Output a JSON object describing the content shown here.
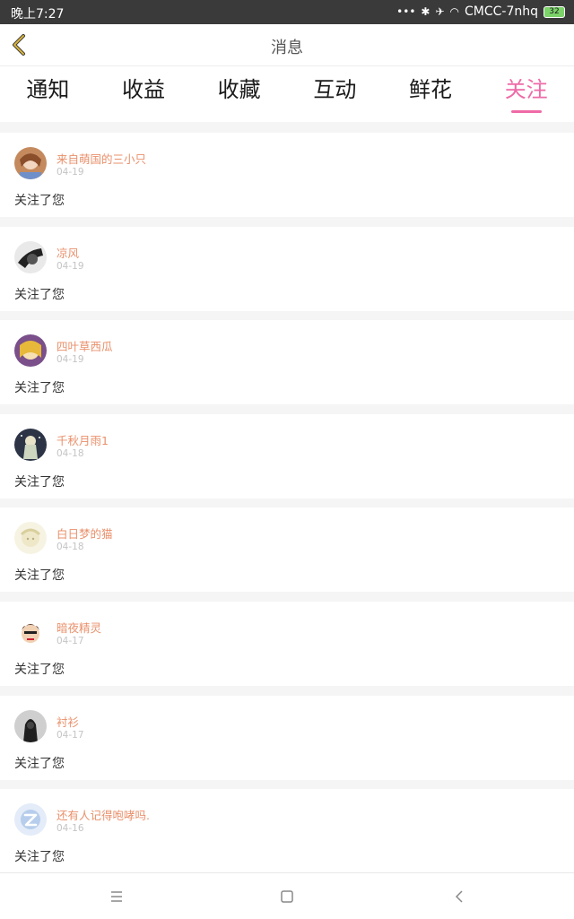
{
  "status_bar": {
    "time": "晚上7:27",
    "carrier": "CMCC-7nhq",
    "battery": "32"
  },
  "header": {
    "title": "消息"
  },
  "tabs": [
    {
      "label": "通知",
      "active": false
    },
    {
      "label": "收益",
      "active": false
    },
    {
      "label": "收藏",
      "active": false
    },
    {
      "label": "互动",
      "active": false
    },
    {
      "label": "鲜花",
      "active": false
    },
    {
      "label": "关注",
      "active": true
    }
  ],
  "colors": {
    "accent": "#ee6aa7",
    "username": "#e9906b",
    "date": "#c4c4c4"
  },
  "follows": [
    {
      "name": "来自萌国的三小只",
      "date": "04-19",
      "message": "关注了您",
      "avatar": "anime-girl-brown"
    },
    {
      "name": "凉风",
      "date": "04-19",
      "message": "关注了您",
      "avatar": "dark-sketch"
    },
    {
      "name": "四叶草西瓜",
      "date": "04-19",
      "message": "关注了您",
      "avatar": "anime-girl-blonde"
    },
    {
      "name": "千秋月雨1",
      "date": "04-18",
      "message": "关注了您",
      "avatar": "night-figure"
    },
    {
      "name": "白日梦的猫",
      "date": "04-18",
      "message": "关注了您",
      "avatar": "pale-cat"
    },
    {
      "name": "暗夜精灵",
      "date": "04-17",
      "message": "关注了您",
      "avatar": "cartoon-face"
    },
    {
      "name": "衬衫",
      "date": "04-17",
      "message": "关注了您",
      "avatar": "dark-hood"
    },
    {
      "name": "还有人记得咆哮吗.",
      "date": "04-16",
      "message": "关注了您",
      "avatar": "default-logo"
    }
  ]
}
